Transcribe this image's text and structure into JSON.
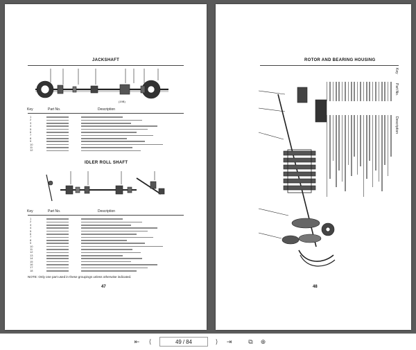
{
  "left_page": {
    "heading_top": "JACKSHAFT",
    "figure_number_top": "(19B)",
    "table_headers": {
      "key": "Key",
      "part_no": "Part No.",
      "description": "Description"
    },
    "top_table_keys": [
      "1",
      "2",
      "3",
      "4",
      "5",
      "6",
      "7",
      "8",
      "9",
      "10",
      "11",
      "12"
    ],
    "heading_bottom": "IDLER ROLL SHAFT",
    "bottom_table_keys": [
      "1",
      "2",
      "3",
      "4",
      "5",
      "6",
      "7",
      "8",
      "9",
      "10",
      "11",
      "12",
      "13",
      "14",
      "15",
      "16",
      "17",
      "18"
    ],
    "note": "NOTE: Only one part used in these groupings unless otherwise indicated.",
    "page_number": "47"
  },
  "right_page": {
    "heading": "ROTOR AND BEARING HOUSING",
    "page_number": "48"
  },
  "toolbar": {
    "current_page": "49",
    "separator": "/",
    "total_pages": "84",
    "first_glyph": "⇤",
    "prev_glyph": "⟨",
    "next_glyph": "⟩",
    "last_glyph": "⇥",
    "view_glyph": "⧉",
    "zoom_glyph": "⊕"
  }
}
